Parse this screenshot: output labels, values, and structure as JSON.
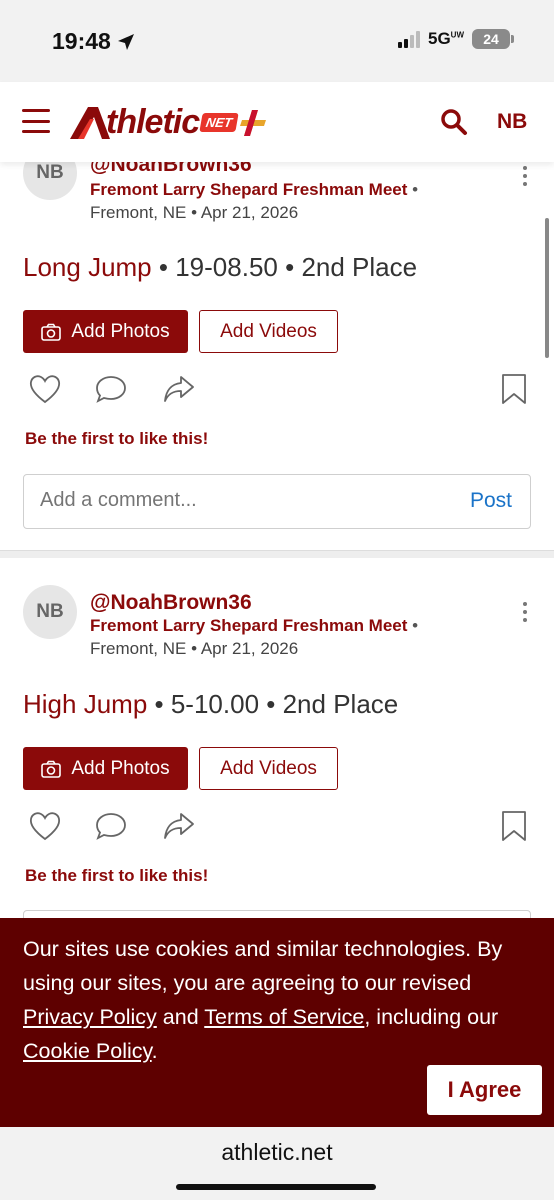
{
  "status_bar": {
    "time": "19:48",
    "network": "5G",
    "network_sup": "UW",
    "battery": "24"
  },
  "header": {
    "user_initials": "NB"
  },
  "posts": [
    {
      "initials": "NB",
      "handle": "@NoahBrown36",
      "meet": "Fremont Larry Shepard Freshman Meet",
      "location": "Fremont, NE",
      "date": "Apr 21, 2026",
      "event": "Long Jump",
      "mark": "19-08.50",
      "place": "2nd Place",
      "add_photos": "Add Photos",
      "add_videos": "Add Videos",
      "like_prompt": "Be the first to like this!",
      "comment_placeholder": "Add a comment...",
      "post_label": "Post"
    },
    {
      "initials": "NB",
      "handle": "@NoahBrown36",
      "meet": "Fremont Larry Shepard Freshman Meet",
      "location": "Fremont, NE",
      "date": "Apr 21, 2026",
      "event": "High Jump",
      "mark": "5-10.00",
      "place": "2nd Place",
      "add_photos": "Add Photos",
      "add_videos": "Add Videos",
      "like_prompt": "Be the first to like this!"
    }
  ],
  "cookie": {
    "text_1": "Our sites use cookies and similar technologies. By using our sites, you are agreeing to our revised ",
    "privacy": "Privacy Policy",
    "and": " and ",
    "terms": "Terms of Service",
    "text_2": ", including our ",
    "cookie_policy": "Cookie Policy",
    "end": ".",
    "agree": "I Agree"
  },
  "url_bar": {
    "domain": "athletic.net"
  },
  "colors": {
    "brand": "#8b0a0a",
    "banner": "#5e0000",
    "link": "#1a73c8"
  }
}
